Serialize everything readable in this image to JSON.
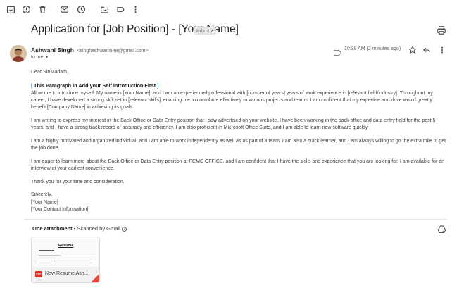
{
  "toolbar": {
    "icons": [
      "archive-icon",
      "report-spam-icon",
      "delete-icon",
      "mark-unread-icon",
      "snooze-icon",
      "move-to-icon",
      "label-icon",
      "more-vert-icon"
    ]
  },
  "message": {
    "subject": "Application for [Job Position] - [Your Name]",
    "label_chip": "Inbox",
    "label_close": "×"
  },
  "sender": {
    "name": "Ashwani Singh",
    "email": "<singhashwani548@gmail.com>",
    "to": "to me",
    "time": "10:39 AM (2 minutes ago)"
  },
  "body": {
    "greeting": "Dear Sir/Madam,",
    "highlight_open": "[",
    "highlight_text": " This Paragraph in Add your Self Introduction First ",
    "highlight_close": "]",
    "p1": "Allow me to introduce myself. My name is [Your Name], and I am an experienced professional with [number of years] years of work experience in [relevant field/industry]. Throughout my career, I have developed a strong skill set in [relevant skills], enabling me to contribute effectively to various projects and teams. I am confident that my expertise and drive would greatly benefit [Company Name] in achieving its goals.",
    "p2": "I am writing to express my interest in the Back Office or Data Entry position that I saw advertised on your website. I have been working in the back office and data entry field for the past 5 years, and I have a strong track record of accuracy and efficiency. I am also proficient in Microsoft Office Suite, and I am able to learn new software quickly.",
    "p3": "I am a highly motivated and organized individual, and I am able to work independently as well as as part of a team. I am also a quick learner, and I am always willing to go the extra mile to get the job done.",
    "p4": "I am eager to learn more about the Back Office or Data Entry position at PCMC OFFICE, and I am confident that I have the skills and experience that you are looking for. I am available for an interview at your earliest convenience.",
    "p5": "Thank you for your time and consideration.",
    "sign_off": "Sincerely,",
    "sign_name": "[Your Name]",
    "sign_contact": "[Your Contact Information]"
  },
  "attachments": {
    "count_label": "One attachment",
    "separator": " • ",
    "scanned_label": "Scanned by Gmail",
    "info_glyph": "i",
    "file_type": "PDF",
    "preview_title": "Resume",
    "file_name": "New Resume Ash..."
  },
  "colors": {
    "chip_bg": "#e4e4e4",
    "link_blue": "#1a73e8",
    "pdf_red": "#d93025"
  }
}
